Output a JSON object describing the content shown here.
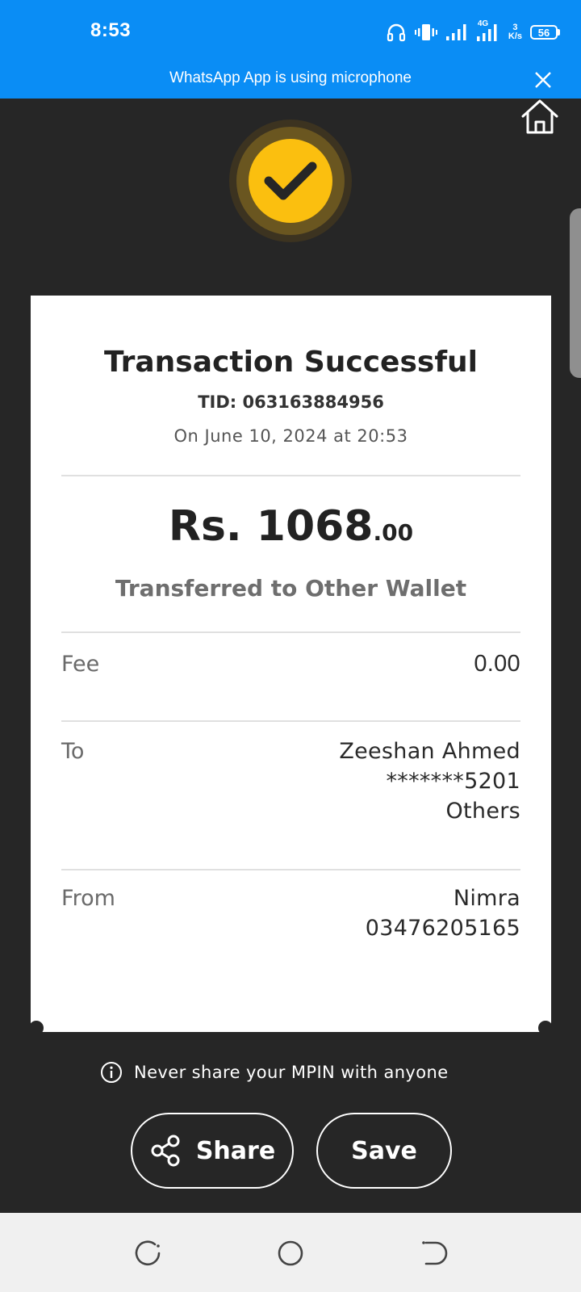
{
  "status_bar": {
    "time": "8:53",
    "network_speed_value": "3",
    "network_speed_unit": "K/s",
    "network_type": "4G",
    "battery_level": "56",
    "banner_text": "WhatsApp App is using microphone",
    "color": "#0a8df5"
  },
  "receipt": {
    "title": "Transaction Successful",
    "tid": "TID: 063163884956",
    "date": "On June 10, 2024 at 20:53",
    "amount_main": "Rs. 1068",
    "amount_decimal": ".00",
    "description": "Transferred to Other Wallet",
    "fee_label": "Fee",
    "fee_value": "0.00",
    "to_label": "To",
    "to_name": "Zeeshan Ahmed",
    "to_account": "*******5201",
    "to_type": "Others",
    "from_label": "From",
    "from_name": "Nimra",
    "from_number": "03476205165"
  },
  "footer": {
    "mpin_notice": "Never share your MPIN with anyone",
    "share_label": "Share",
    "save_label": "Save"
  },
  "colors": {
    "background": "#262626",
    "accent": "#fbbf0f",
    "card": "#ffffff"
  }
}
